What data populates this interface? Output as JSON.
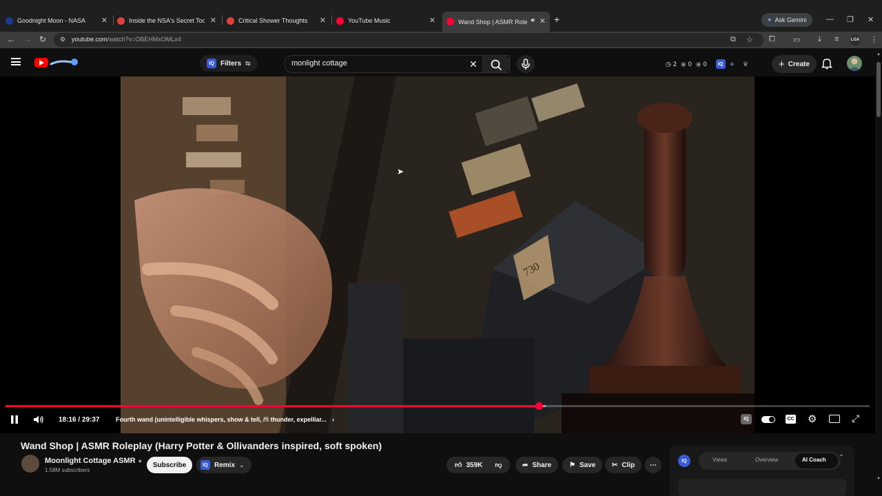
{
  "browser": {
    "tabs": [
      {
        "title": "Goodnight Moon - NASA",
        "favicon_color": "#1a3a8f"
      },
      {
        "title": "Inside the NSA's Secret Tool for",
        "favicon_color": "#e04040"
      },
      {
        "title": "Critical Shower Thoughts",
        "favicon_color": "#e04040"
      },
      {
        "title": "YouTube Music",
        "favicon_color": "#ff0033"
      },
      {
        "title": "Wand Shop | ASMR Roleplay",
        "favicon_color": "#ff0033",
        "active": true
      }
    ],
    "new_tab_icon": "plus-icon",
    "gemini_label": "Ask Gemini",
    "url_host": "youtube.com",
    "url_path": "/watch?v=OBEHMxOMLx4",
    "profile_label": "LGA"
  },
  "header": {
    "filters_label": "Filters",
    "search_value": "monlight cottage",
    "stats": {
      "clock": "2",
      "views": "0",
      "eye": "0"
    },
    "create_label": "Create",
    "accent": "#ff0033"
  },
  "player": {
    "current_time": "18:16",
    "duration": "29:37",
    "time_display": "18:16 / 29:37",
    "chapter": "Fourth wand (unintelligible whispers, show & tell, /!\\ thunder, expelliar...",
    "progress_fraction": 0.617,
    "buffer_fraction": 0.625,
    "box_label": "730"
  },
  "video": {
    "title": "Wand Shop | ASMR Roleplay (Harry Potter & Ollivanders inspired, soft spoken)",
    "channel": "Moonlight Cottage ASMR",
    "subscribers": "1.58M subscribers",
    "subscribe_label": "Subscribe",
    "remix_label": "Remix",
    "likes": "359K",
    "share_label": "Share",
    "save_label": "Save",
    "clip_label": "Clip"
  },
  "side_panel": {
    "tabs": [
      "Views",
      "Overview",
      "AI Coach"
    ],
    "active_tab": "AI Coach"
  }
}
